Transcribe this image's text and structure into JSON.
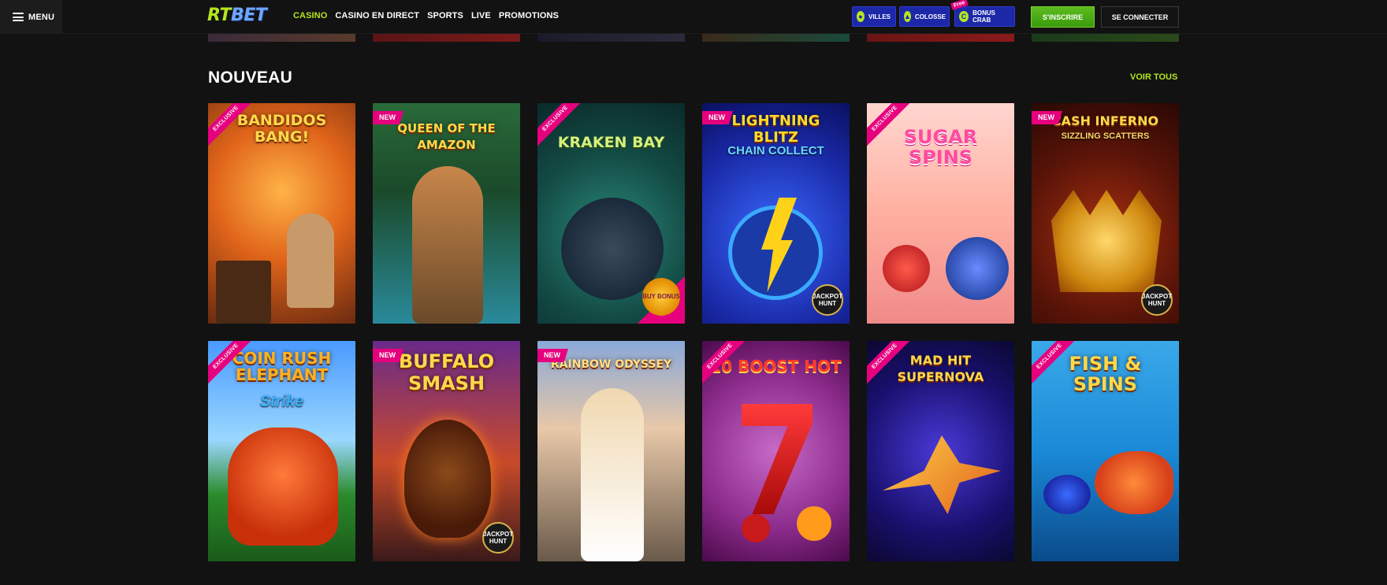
{
  "header": {
    "menu_label": "MENU",
    "logo_rt": "RT",
    "logo_bet": "BET",
    "nav": [
      {
        "label": "CASINO",
        "active": true
      },
      {
        "label": "CASINO EN DIRECT",
        "active": false
      },
      {
        "label": "SPORTS",
        "active": false
      },
      {
        "label": "LIVE",
        "active": false
      },
      {
        "label": "PROMOTIONS",
        "active": false
      }
    ],
    "promos": [
      {
        "label": "VILLES",
        "icon": "map-pin-icon"
      },
      {
        "label": "COLOSSE",
        "icon": "trophy-icon"
      },
      {
        "label": "BONUS CRAB",
        "icon": "crab-icon"
      }
    ],
    "free_tag": "Free",
    "signup_label": "S'INSCRIRE",
    "login_label": "SE CONNECTER"
  },
  "section": {
    "title": "NOUVEAU",
    "see_all_label": "VOIR TOUS"
  },
  "badges": {
    "exclusive": "EXCLUSIVE",
    "new": "NEW",
    "jackpot": "JACKPOT HUNT",
    "buy_bonus": "BUY BONUS"
  },
  "games": [
    {
      "title": "BANDIDOS BANG!",
      "subtitle": "",
      "ribbon": "exclusive",
      "badge": ""
    },
    {
      "title": "QUEEN OF THE AMAZON",
      "subtitle": "",
      "ribbon": "new",
      "badge": ""
    },
    {
      "title": "KRAKEN BAY",
      "subtitle": "",
      "ribbon": "exclusive",
      "badge": "buy_bonus"
    },
    {
      "title": "LIGHTNING BLITZ",
      "subtitle": "CHAIN COLLECT",
      "ribbon": "new",
      "badge": "jackpot"
    },
    {
      "title": "SUGAR SPINS",
      "subtitle": "",
      "ribbon": "exclusive",
      "badge": ""
    },
    {
      "title": "CASH INFERNO",
      "subtitle": "SIZZLING SCATTERS",
      "ribbon": "new",
      "badge": "jackpot"
    },
    {
      "title": "COIN RUSH ELEPHANT",
      "subtitle": "Strike",
      "ribbon": "exclusive",
      "badge": ""
    },
    {
      "title": "BUFFALO SMASH",
      "subtitle": "",
      "ribbon": "new",
      "badge": "jackpot"
    },
    {
      "title": "RAINBOW ODYSSEY",
      "subtitle": "",
      "ribbon": "new",
      "badge": ""
    },
    {
      "title": "10 BOOST HOT",
      "subtitle": "",
      "ribbon": "exclusive",
      "badge": ""
    },
    {
      "title": "MAD HIT SUPERNOVA",
      "subtitle": "",
      "ribbon": "exclusive",
      "badge": ""
    },
    {
      "title": "FISH & SPINS",
      "subtitle": "",
      "ribbon": "exclusive",
      "badge": ""
    }
  ],
  "colors": {
    "background": "#121212",
    "accent": "#b4e61e",
    "ribbon": "#e6007e",
    "promo": "#1d28a8"
  }
}
